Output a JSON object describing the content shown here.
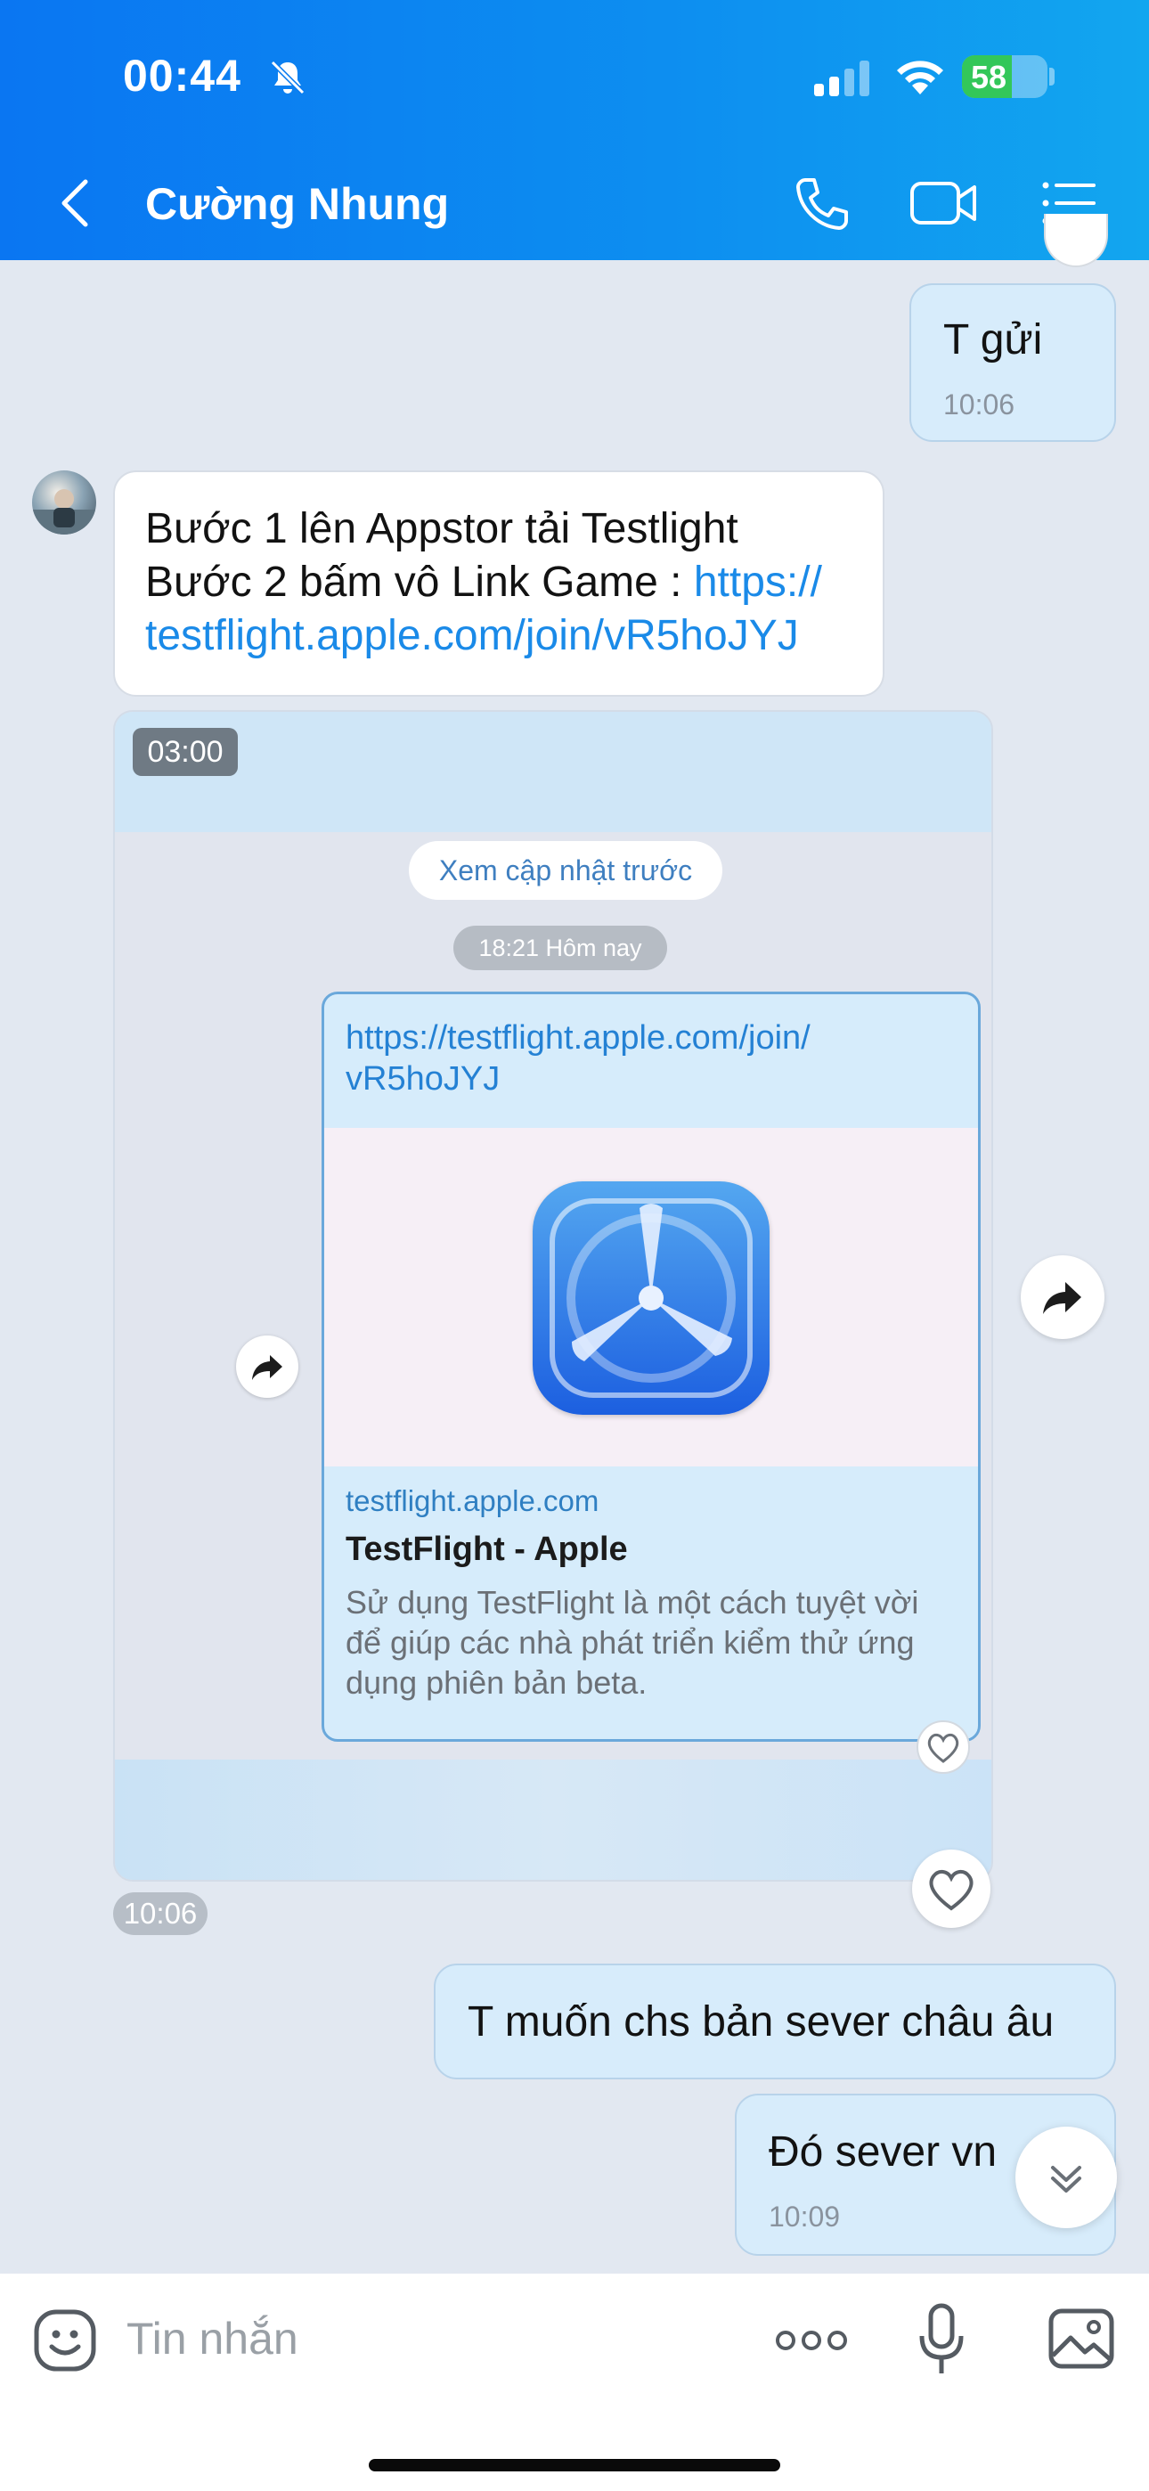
{
  "status_bar": {
    "time": "00:44",
    "battery": "58",
    "battery_level": 0.58,
    "icons": [
      "bell-off-icon",
      "signal-icon",
      "wifi-icon",
      "battery-icon"
    ]
  },
  "header": {
    "contact_name": "Cường Nhung",
    "icons": [
      "back-icon",
      "phone-icon",
      "video-call-icon",
      "menu-list-icon"
    ],
    "accent": "#0a76f2"
  },
  "messages": [
    {
      "id": "m1",
      "type": "sent",
      "text": "T gửi",
      "time": "10:06"
    },
    {
      "id": "m2",
      "type": "received",
      "line1": "Bước 1 lên Appstor tải Testlight",
      "line2_prefix": "Bước 2 bấm vô Link Game : ",
      "line2_link_a": "https://",
      "line3_link": "testflight.apple.com/join/vR5hoJYJ"
    },
    {
      "id": "m3",
      "type": "received-image",
      "video_duration": "03:00",
      "older_updates": "Xem cập nhật trước",
      "date_chip": "18:21 Hôm nay",
      "inner_url_1": "https://testflight.apple.com/join/",
      "inner_url_2": "vR5hoJYJ",
      "inner_domain": "testflight.apple.com",
      "inner_title": "TestFlight - Apple",
      "inner_desc_1": "Sử dụng TestFlight là một cách tuyệt vời",
      "inner_desc_2": "để giúp các nhà phát triển kiểm thử ứng",
      "inner_desc_3": "dụng phiên bản beta.",
      "time": "10:06"
    },
    {
      "id": "m4",
      "type": "sent",
      "text": "T muốn chs bản sever châu âu"
    },
    {
      "id": "m5",
      "type": "sent",
      "text": "Đó sever vn",
      "time": "10:09"
    }
  ],
  "composer": {
    "placeholder": "Tin nhắn",
    "icons": [
      "sticker-icon",
      "more-icon",
      "mic-icon",
      "image-icon"
    ]
  },
  "colors": {
    "sent_bubble": "#d7ecfb",
    "received_bubble": "#ffffff",
    "link": "#1a8ae8",
    "chat_background": "#e2e8f1"
  }
}
